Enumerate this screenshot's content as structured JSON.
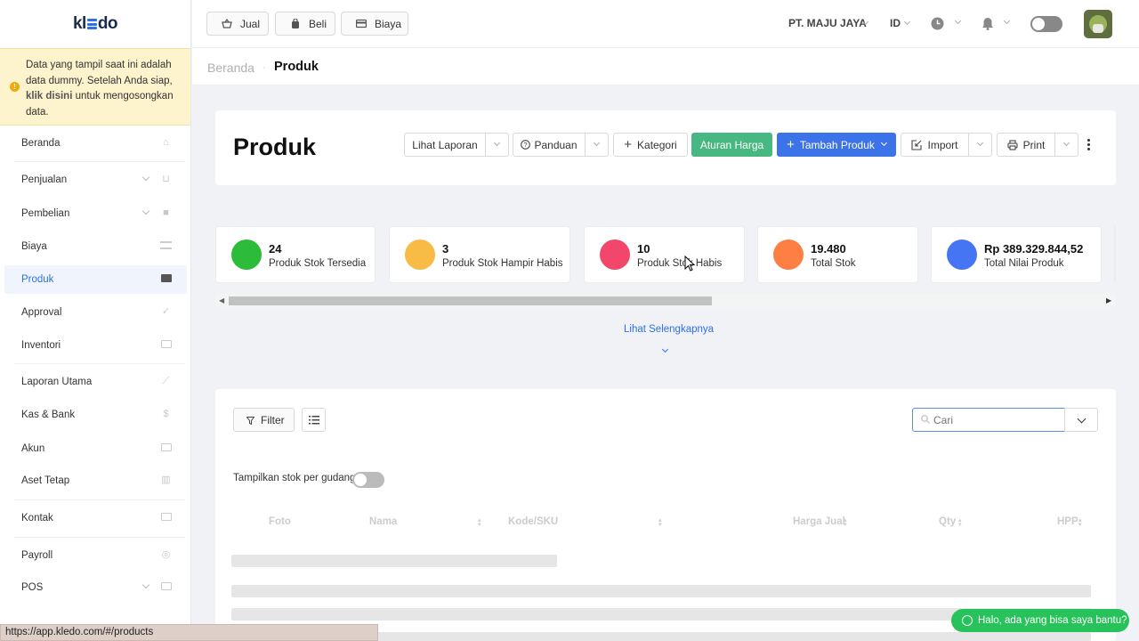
{
  "sidebar": {
    "logo": {
      "a": "kl",
      "b": "do"
    },
    "notice": {
      "pre": "Data yang tampil saat ini adalah data dummy. Setelah Anda siap, ",
      "link": "klik disini",
      "post": " untuk mengosongkan data."
    },
    "items": [
      {
        "label": "Beranda",
        "icon": "home-icon"
      },
      {
        "label": "Penjualan",
        "icon": "basket-icon",
        "expandable": true
      },
      {
        "label": "Pembelian",
        "icon": "bag-icon",
        "expandable": true
      },
      {
        "label": "Biaya",
        "icon": "card-icon"
      },
      {
        "label": "Produk",
        "icon": "box-icon",
        "active": true
      },
      {
        "label": "Approval",
        "icon": "check-icon"
      },
      {
        "label": "Inventori",
        "icon": "briefcase-icon"
      },
      {
        "label": "Laporan Utama",
        "icon": "chart-icon"
      },
      {
        "label": "Kas & Bank",
        "icon": "dollar-icon"
      },
      {
        "label": "Akun",
        "icon": "ledger-icon"
      },
      {
        "label": "Aset Tetap",
        "icon": "building-icon"
      },
      {
        "label": "Kontak",
        "icon": "contact-icon"
      },
      {
        "label": "Payroll",
        "icon": "payroll-icon"
      },
      {
        "label": "POS",
        "icon": "pos-icon",
        "expandable": true
      }
    ]
  },
  "topbar": {
    "buttons": [
      {
        "label": "Jual"
      },
      {
        "label": "Beli"
      },
      {
        "label": "Biaya"
      }
    ],
    "company": "PT. MAJU JAYA",
    "lang": "ID"
  },
  "breadcrumb": {
    "home": "Beranda",
    "current": "Produk"
  },
  "page": {
    "title": "Produk",
    "actions": {
      "report": "Lihat Laporan",
      "guide": "Panduan",
      "category": "Kategori",
      "price_rules": "Aturan Harga",
      "add_product": "Tambah Produk",
      "import": "Import",
      "print": "Print"
    }
  },
  "stats": [
    {
      "value": "24",
      "label": "Produk Stok Tersedia",
      "color": "#2dbb3a"
    },
    {
      "value": "3",
      "label": "Produk Stok Hampir Habis",
      "color": "#f7bb46"
    },
    {
      "value": "10",
      "label": "Produk Stok Habis",
      "color": "#f2466a"
    },
    {
      "value": "19.480",
      "label": "Total Stok",
      "color": "#fd7f43"
    },
    {
      "value": "Rp 389.329.844,52",
      "label": "Total Nilai Produk",
      "color": "#4675f4"
    }
  ],
  "more_link": "Lihat Selengkapnya",
  "table": {
    "filter": "Filter",
    "search_placeholder": "Cari",
    "stock_toggle": "Tampilkan stok per gudang",
    "columns": [
      "Foto",
      "Nama",
      "Kode/SKU",
      "Harga Jual",
      "Qty",
      "HPP"
    ]
  },
  "status_url": "https://app.kledo.com/#/products",
  "whatsapp": "Halo, ada yang bisa saya bantu?",
  "colors": {
    "accent": "#2f6fe8",
    "green": "#47b881",
    "blue": "#3d73e8"
  }
}
